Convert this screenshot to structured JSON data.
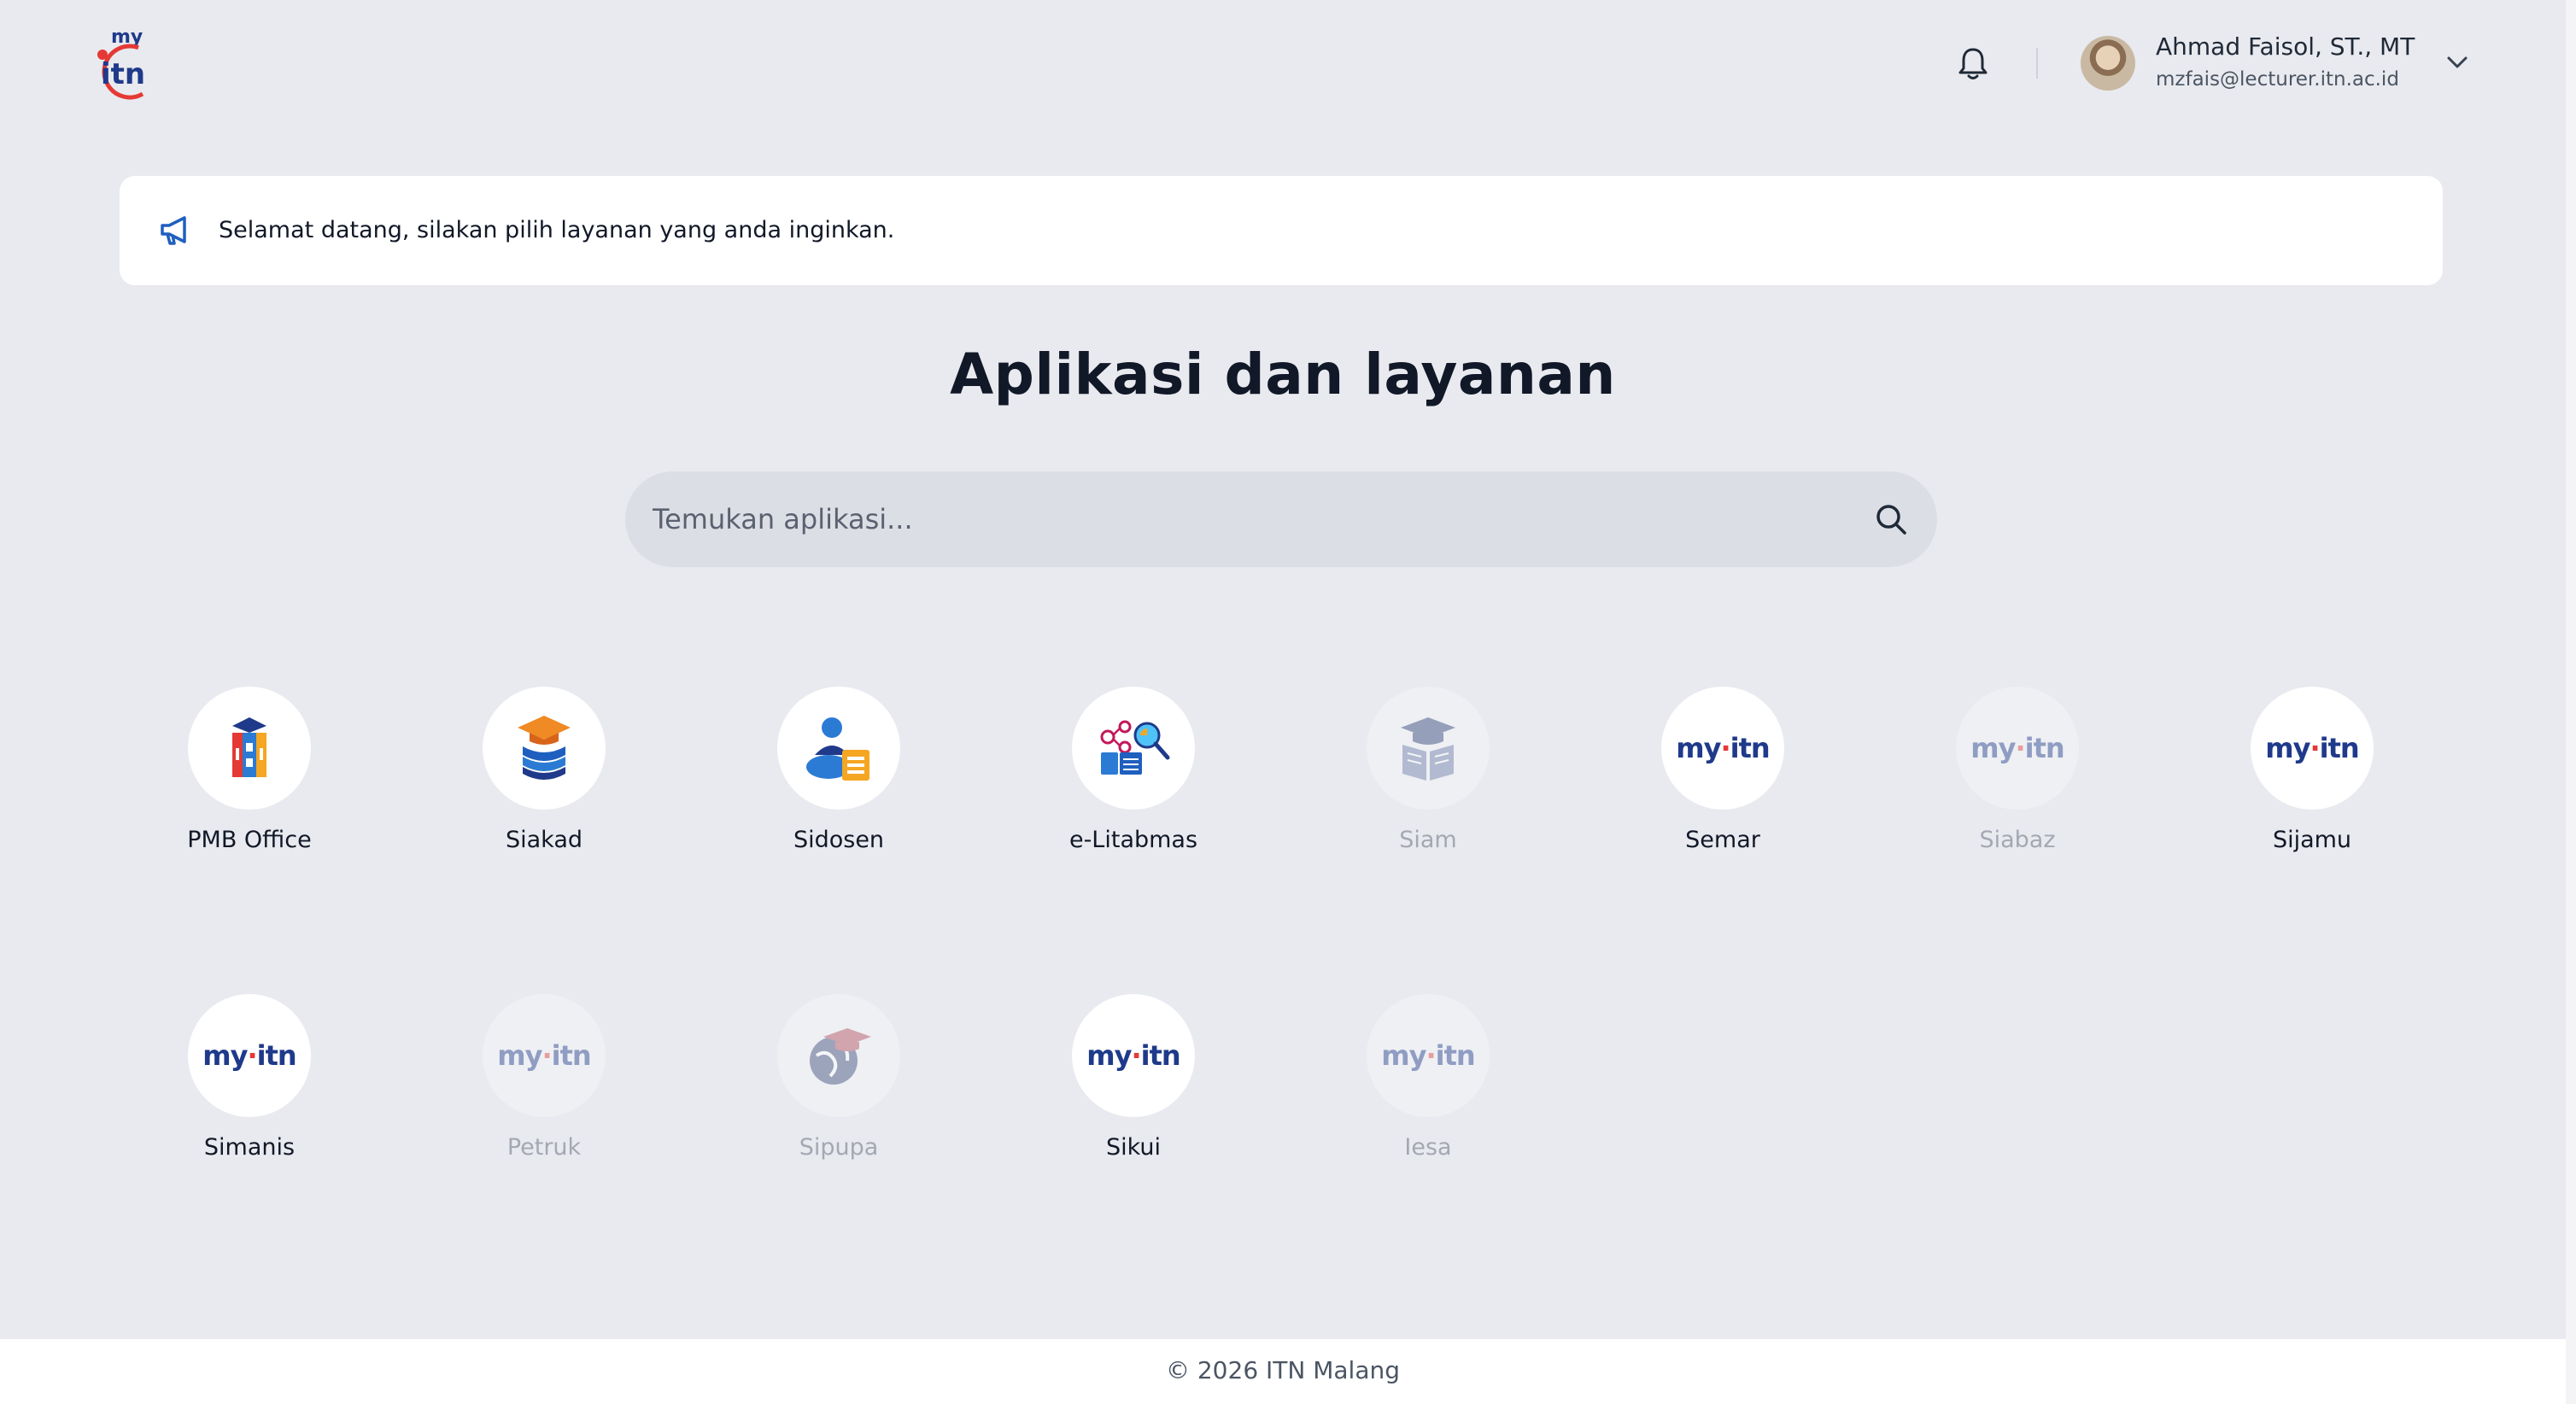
{
  "header": {
    "logo": {
      "text_my": "my",
      "text_itn": "itn"
    },
    "notification_icon": "bell-icon",
    "user": {
      "name": "Ahmad Faisol, ST., MT",
      "email": "mzfais@lecturer.itn.ac.id"
    },
    "dropdown_icon": "chevron-down-icon"
  },
  "banner": {
    "icon": "megaphone-icon",
    "message": "Selamat datang, silakan pilih layanan yang anda inginkan."
  },
  "main": {
    "title": "Aplikasi dan layanan",
    "search": {
      "placeholder": "Temukan aplikasi...",
      "value": ""
    }
  },
  "apps": [
    {
      "label": "PMB Office",
      "icon": "pmb-office-icon",
      "enabled": true
    },
    {
      "label": "Siakad",
      "icon": "siakad-icon",
      "enabled": true
    },
    {
      "label": "Sidosen",
      "icon": "sidosen-icon",
      "enabled": true
    },
    {
      "label": "e-Litabmas",
      "icon": "e-litabmas-icon",
      "enabled": true
    },
    {
      "label": "Siam",
      "icon": "siam-icon",
      "enabled": false
    },
    {
      "label": "Semar",
      "icon": "myitn-logo-icon",
      "enabled": true
    },
    {
      "label": "Siabaz",
      "icon": "myitn-logo-icon",
      "enabled": false
    },
    {
      "label": "Sijamu",
      "icon": "myitn-logo-icon",
      "enabled": true
    },
    {
      "label": "Simanis",
      "icon": "myitn-logo-icon",
      "enabled": true
    },
    {
      "label": "Petruk",
      "icon": "myitn-logo-icon",
      "enabled": false
    },
    {
      "label": "Sipupa",
      "icon": "sipupa-icon",
      "enabled": false
    },
    {
      "label": "Sikui",
      "icon": "myitn-logo-icon",
      "enabled": true
    },
    {
      "label": "Iesa",
      "icon": "myitn-logo-icon",
      "enabled": false
    }
  ],
  "footer": {
    "copyright": "© 2026 ITN Malang"
  },
  "colors": {
    "background": "#e9eaef",
    "brand_blue": "#1f3a8a",
    "brand_red": "#e53935",
    "disabled_text": "#a3a8b3"
  }
}
